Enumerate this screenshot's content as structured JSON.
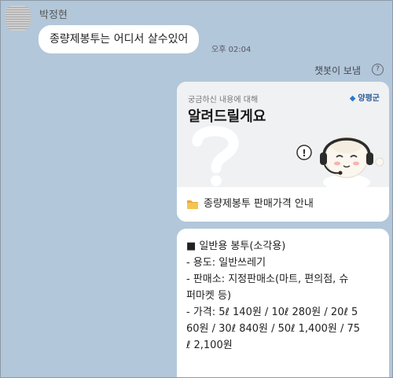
{
  "chat": {
    "sender_name": "박정현",
    "message_text": "종량제봉투는 어디서 살수있어",
    "message_time": "오후 02:04",
    "bot_sent_label": "챗봇이 보냄"
  },
  "card": {
    "subtitle": "궁금하신 내용에 대해",
    "title": "알려드릴게요",
    "org_name": "양평군",
    "link_label": "종량제봉투 판매가격 안내",
    "hero_icon": "question-mark-icon",
    "mascot": "headset-mascot-illustration"
  },
  "info": {
    "lines": [
      "■ 일반용 봉투(소각용)",
      "- 용도: 일반쓰레기",
      "- 판매소: 지정판매소(마트, 편의점, 슈",
      "퍼마켓 등)",
      "- 가격: 5ℓ 140원 / 10ℓ 280원 / 20ℓ 5",
      "60원 / 30ℓ 840원 / 50ℓ 1,400원 / 75",
      "ℓ 2,100원"
    ]
  },
  "colors": {
    "background": "#b2c7d9",
    "bubble": "#ffffff",
    "hero_bg": "#f0f1f3",
    "org_blue": "#2a5a9a"
  }
}
